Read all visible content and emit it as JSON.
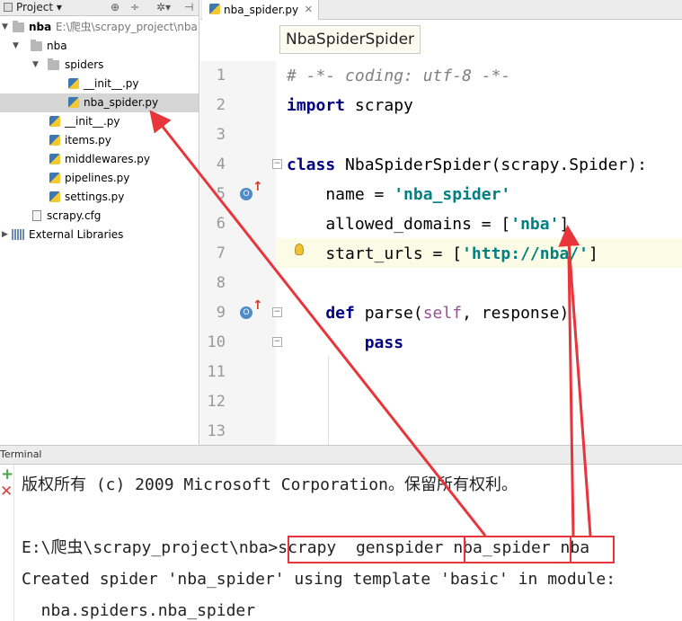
{
  "project_panel": {
    "title": "Project",
    "toolbar_icons": [
      "globe-icon",
      "collapse-icon",
      "gear-icon",
      "hide-icon"
    ],
    "tree": [
      {
        "name": "nba",
        "note": "E:\\爬虫\\scrapy_project\\nba",
        "kind": "root-folder"
      },
      {
        "name": "nba",
        "kind": "folder"
      },
      {
        "name": "spiders",
        "kind": "folder"
      },
      {
        "name": "__init__.py",
        "kind": "py"
      },
      {
        "name": "nba_spider.py",
        "kind": "py",
        "selected": true
      },
      {
        "name": "__init__.py",
        "kind": "py"
      },
      {
        "name": "items.py",
        "kind": "py"
      },
      {
        "name": "middlewares.py",
        "kind": "py"
      },
      {
        "name": "pipelines.py",
        "kind": "py"
      },
      {
        "name": "settings.py",
        "kind": "py"
      },
      {
        "name": "scrapy.cfg",
        "kind": "cfg"
      },
      {
        "name": "External Libraries",
        "kind": "lib"
      }
    ]
  },
  "editor": {
    "tab_label": "nba_spider.py",
    "breadcrumb": "NbaSpiderSpider",
    "line_numbers": [
      "1",
      "2",
      "3",
      "4",
      "5",
      "6",
      "7",
      "8",
      "9",
      "10",
      "11",
      "12",
      "13"
    ],
    "code": {
      "l1": "# -*- coding: utf-8 -*-",
      "l2_kw": "import",
      "l2_rest": " scrapy",
      "l4_kw": "class",
      "l4_rest": " NbaSpiderSpider(scrapy.Spider):",
      "l5_a": "    name = ",
      "l5_str": "'nba_spider'",
      "l6_a": "    allowed_domains = [",
      "l6_str": "'nba'",
      "l6_b": "]",
      "l7_a": "    start_urls = [",
      "l7_str": "'http://nba/'",
      "l7_b": "]",
      "l9_kw": "    def",
      "l9_a": " parse(",
      "l9_self": "self",
      "l9_b": ", response):",
      "l10_kw": "        pass"
    }
  },
  "terminal": {
    "title": "Terminal",
    "line1": "版权所有 (c) 2009 Microsoft Corporation。保留所有权利。",
    "prompt": "E:\\爬虫\\scrapy_project\\nba>",
    "cmd_part1": "scrapy  genspider ",
    "cmd_part2": "nba_spider",
    "cmd_part3": " nba",
    "line4": "Created spider 'nba_spider' using template 'basic' in module:",
    "line5": "  nba.spiders.nba_spider"
  },
  "colors": {
    "annotation": "#e8353b",
    "keyword": "#000080",
    "string": "#008080"
  }
}
